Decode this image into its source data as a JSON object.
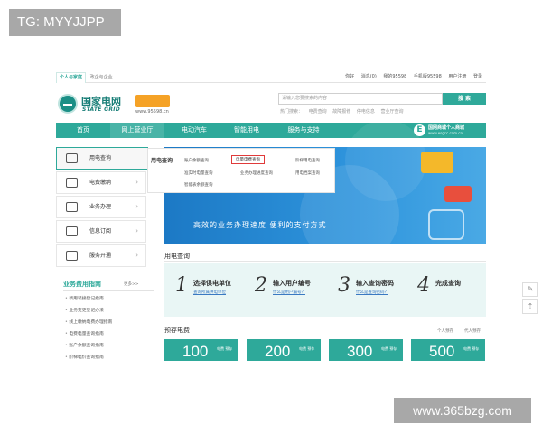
{
  "watermark_tag": "TG: MYYJJPP",
  "watermark_site": "www.365bzg.com",
  "topbar": {
    "tabs": [
      "个人与家庭",
      "政企与企业"
    ],
    "user": "你好",
    "items": [
      "消息(0)",
      "我的95598",
      "手机版95598",
      "用户注册",
      "登录"
    ]
  },
  "header": {
    "logo_cn": "国家电网",
    "logo_en": "STATE GRID",
    "badge_url": "www.95598.cn",
    "search_placeholder": "请输入您要搜索的内容",
    "search_button": "搜 索",
    "hot_label": "热门搜索：",
    "hot_words": [
      "电费查询",
      "故障报修",
      "停电信息",
      "营业厅查询"
    ]
  },
  "nav": {
    "items": [
      "首页",
      "网上营业厅",
      "电动汽车",
      "智能用电",
      "服务与支持"
    ],
    "mall_cn": "国网商城个人商城",
    "mall_en": "www.esgcc.com.cn"
  },
  "sidebar": {
    "items": [
      "用电查询",
      "电费缴纳",
      "业务办理",
      "信息订阅",
      "服务开通"
    ]
  },
  "dropdown": {
    "heading": "用电查询",
    "links": [
      "账户余额查询",
      "电量电费查询",
      "阶梯用电查询",
      "准实时电量查询",
      "业务办理进度查询",
      "用电档案查询",
      "智能表余额查询"
    ]
  },
  "banner": {
    "slogan": "高效的业务办理速度  便利的支付方式"
  },
  "query": {
    "title": "用电查询",
    "steps": [
      {
        "num": "1",
        "label": "选择供电单位",
        "link": "查询所属供电单位"
      },
      {
        "num": "2",
        "label": "输入用户编号",
        "link": "什么是用户编号？"
      },
      {
        "num": "3",
        "label": "输入查询密码",
        "link": "什么是查询密码？"
      },
      {
        "num": "4",
        "label": "完成查询",
        "link": ""
      }
    ]
  },
  "prepay": {
    "title": "预存电费",
    "links": [
      "个人预存",
      "代人预存"
    ],
    "tiles": [
      {
        "amount": "100",
        "unit": "电费 预存"
      },
      {
        "amount": "200",
        "unit": "电费 预存"
      },
      {
        "amount": "300",
        "unit": "电费 预存"
      },
      {
        "amount": "500",
        "unit": "电费 预存"
      }
    ]
  },
  "guide": {
    "title": "业务费用指南",
    "more": "更多>>",
    "items": [
      "新用装接登记指南",
      "业务变更登记办法",
      "线上缴纳电费办理指南",
      "电费电量查询指南",
      "账户余额查询指南",
      "阶梯电价查询指南"
    ]
  },
  "tools": [
    "edit-icon",
    "top-icon"
  ],
  "colors": {
    "brand": "#2ea99a",
    "banner": "#2f95dd",
    "highlight": "#e03a3a",
    "badge": "#f5a226"
  }
}
